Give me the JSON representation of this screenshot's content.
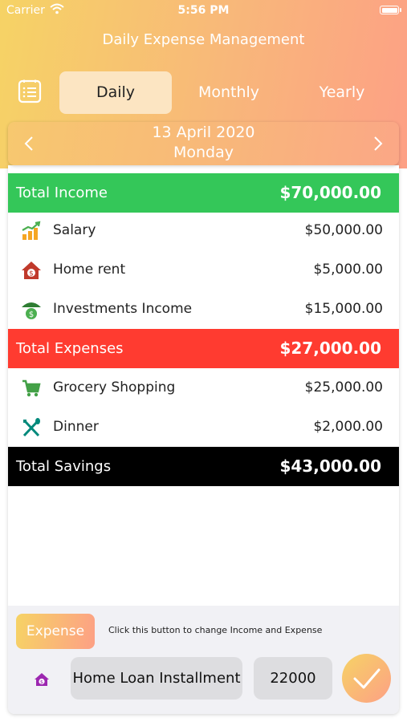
{
  "status_bar": {
    "carrier": "Carrier",
    "time": "5:56 PM"
  },
  "header": {
    "title": "Daily Expense Management"
  },
  "tabs": [
    {
      "label": "Daily",
      "active": true
    },
    {
      "label": "Monthly",
      "active": false
    },
    {
      "label": "Yearly",
      "active": false
    }
  ],
  "date": {
    "date": "13 April 2020",
    "weekday": "Monday"
  },
  "income": {
    "label": "Total Income",
    "total": "$70,000.00",
    "color": "#34c759",
    "items": [
      {
        "label": "Salary",
        "amount": "$50,000.00",
        "icon": "growth-chart-icon"
      },
      {
        "label": "Home rent",
        "amount": "$5,000.00",
        "icon": "house-dollar-icon"
      },
      {
        "label": "Investments Income",
        "amount": "$15,000.00",
        "icon": "money-bag-umbrella-icon"
      }
    ]
  },
  "expenses": {
    "label": "Total Expenses",
    "total": "$27,000.00",
    "color": "#ff3b30",
    "items": [
      {
        "label": "Grocery Shopping",
        "amount": "$25,000.00",
        "icon": "shopping-cart-icon"
      },
      {
        "label": "Dinner",
        "amount": "$2,000.00",
        "icon": "fork-knife-icon"
      }
    ]
  },
  "savings": {
    "label": "Total Savings",
    "total": "$43,000.00",
    "color": "#000000"
  },
  "entry": {
    "type_button": "Expense",
    "hint": "Click this button to change Income and Expense",
    "description": "Home Loan Installment",
    "amount": "22000"
  }
}
